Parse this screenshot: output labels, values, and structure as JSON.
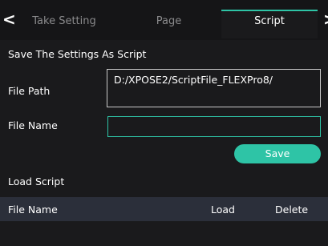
{
  "tabs": [
    {
      "label": "Take Setting"
    },
    {
      "label": "Page"
    },
    {
      "label": "Script"
    }
  ],
  "nav": {
    "left_arrow": "<",
    "right_arrow": ">"
  },
  "save_section": {
    "title": "Save The Settings As Script",
    "file_path_label": "File Path",
    "file_path_value": "D:/XPOSE2/ScriptFile_FLEXPro8/",
    "file_name_label": "File Name",
    "file_name_value": "",
    "save_label": "Save"
  },
  "load_section": {
    "title": "Load Script",
    "columns": [
      "File Name",
      "Load",
      "Delete"
    ]
  },
  "colors": {
    "accent": "#2ec4a6",
    "background": "#1a1a1c",
    "header_row": "#2b2f3a"
  }
}
